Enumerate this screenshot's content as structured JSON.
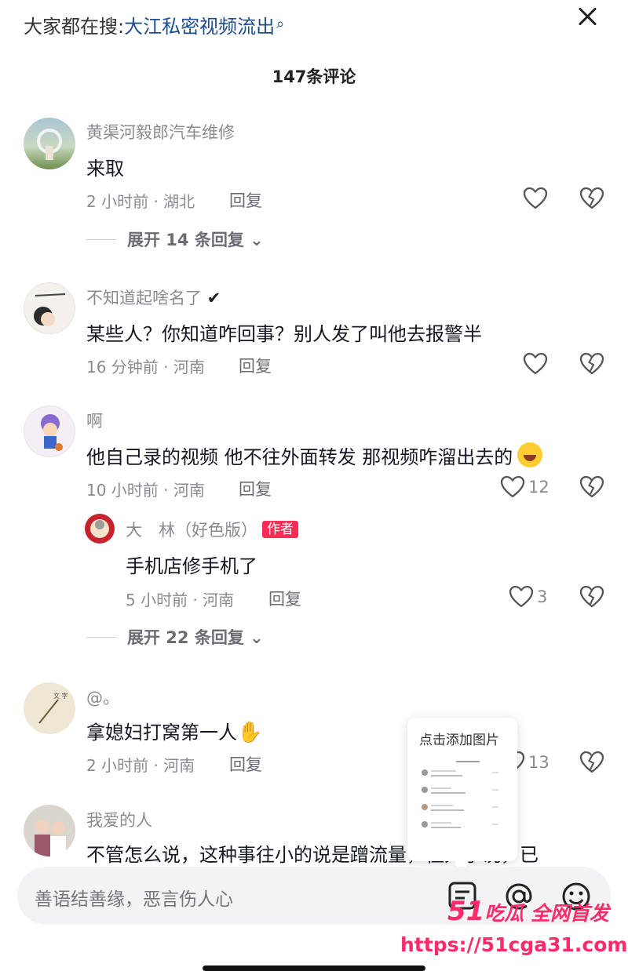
{
  "search": {
    "prefix": "大家都在搜:",
    "keyword": "大江私密视频流出",
    "icon": "search-icon"
  },
  "header": {
    "count_label": "147条评论"
  },
  "comments": [
    {
      "user": "黄渠河毅郎汽车维修",
      "text": "来取",
      "meta": "2 小时前 · 湖北",
      "reply": "回复",
      "likes": "",
      "expand": "展开 14 条回复"
    },
    {
      "user": "不知道起啥名了",
      "text": "某些人？你知道咋回事？别人发了叫他去报警半",
      "meta": "16 分钟前 · 河南",
      "reply": "回复",
      "likes": ""
    },
    {
      "user": "啊",
      "text": "他自己录的视频 他不往外面转发 那视频咋溜出去的",
      "meta": "10 小时前 · 河南",
      "reply": "回复",
      "likes": "12",
      "sub_reply": {
        "user": "大　林（好色版）",
        "badge": "作者",
        "text": "手机店修手机了",
        "meta": "5 小时前 · 河南",
        "reply": "回复",
        "likes": "3"
      },
      "expand": "展开 22 条回复"
    },
    {
      "user": "@。",
      "text": "拿媳妇打窝第一人",
      "meta": "2 小时前 · 河南",
      "reply": "回复",
      "likes": "13"
    },
    {
      "user": "我爱的人",
      "text": "不管怎么说，这种事往小的说是蹭流量，往大了说，已"
    }
  ],
  "popup": {
    "title": "点击添加图片"
  },
  "input": {
    "placeholder": "善语结善缘，恶言伤人心"
  },
  "watermark": {
    "line1": "51",
    "line1b": "吃瓜 全网首发",
    "line2": "https://51cga31.com"
  },
  "colors": {
    "accent": "#ff2d55",
    "link": "#1e4e8c",
    "watermark": "#ff2a6a"
  }
}
